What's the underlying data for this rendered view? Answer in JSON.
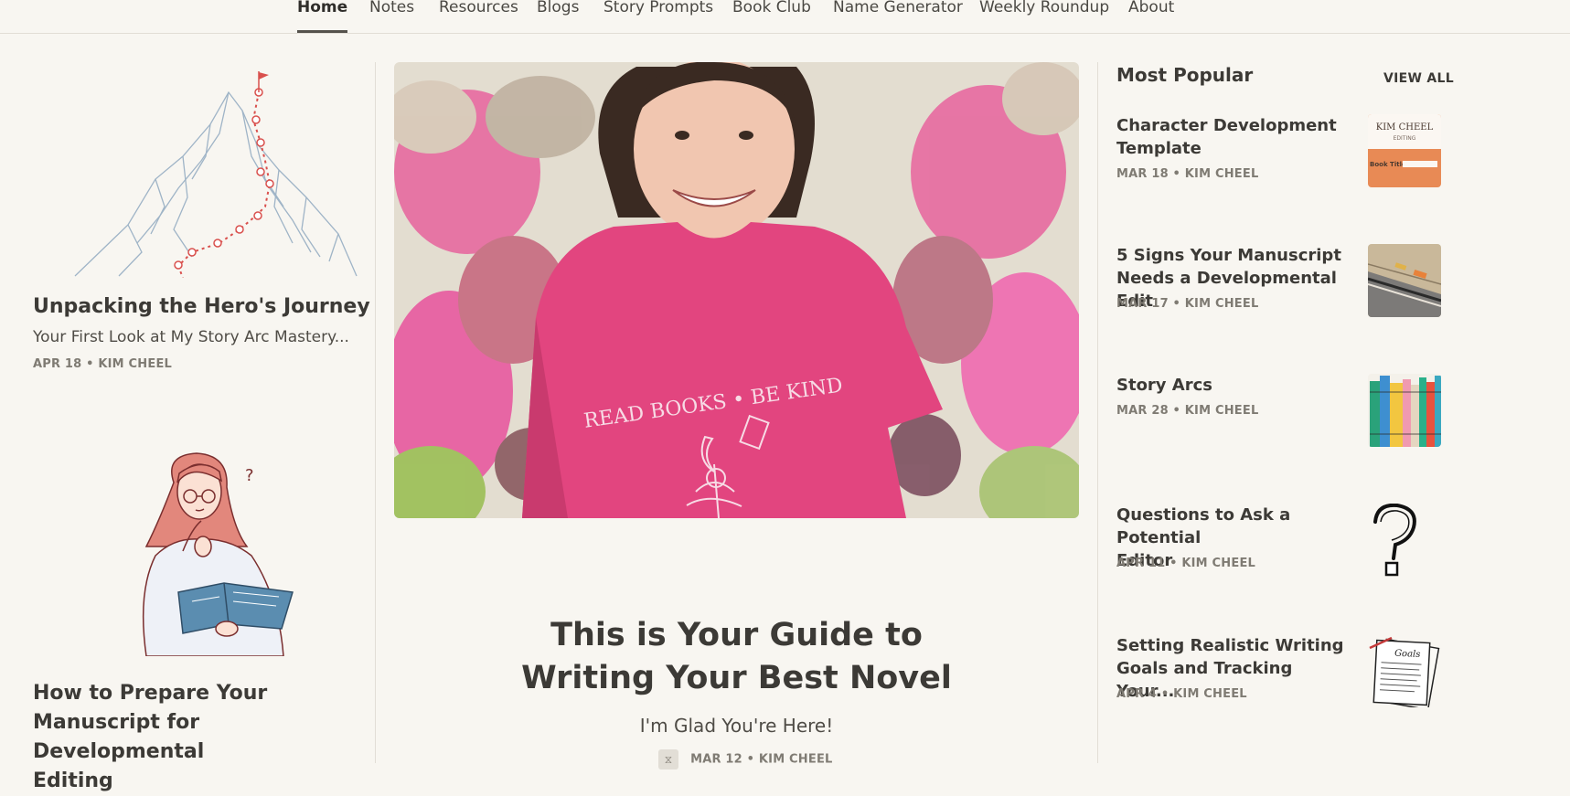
{
  "nav": {
    "items": [
      "Home",
      "Notes",
      "Resources",
      "Blogs",
      "Story Prompts",
      "Book Club",
      "Name Generator",
      "Weekly Roundup",
      "About"
    ]
  },
  "left": {
    "post1": {
      "title": "Unpacking the Hero's Journey",
      "subtitle": "Your First Look at My Story Arc Mastery...",
      "meta": "APR 18 • KIM CHEEL"
    },
    "post2": {
      "title_lines": [
        "How to Prepare Your",
        "Manuscript for Developmental",
        "Editing"
      ]
    }
  },
  "center": {
    "title_lines": [
      "This is Your Guide to",
      "Writing Your Best Novel"
    ],
    "subtitle": "I'm Glad You're Here!",
    "meta": "MAR 12 • KIM CHEEL",
    "shirt_text": "READ BOOKS • BE KIND"
  },
  "right": {
    "heading": "Most Popular",
    "view_all": "VIEW ALL",
    "items": [
      {
        "title_lines": [
          "Character Development",
          "Template"
        ],
        "meta": "MAR 18 • KIM CHEEL",
        "thumb_text": [
          "KIM CHEEL",
          "EDITING",
          "Book Title:"
        ]
      },
      {
        "title_lines": [
          "5 Signs Your Manuscript",
          "Needs a Developmental Edit"
        ],
        "meta": "MAR 17 • KIM CHEEL"
      },
      {
        "title_lines": [
          "Story Arcs"
        ],
        "meta": "MAR 28 • KIM CHEEL"
      },
      {
        "title_lines": [
          "Questions to Ask a Potential",
          "Editor"
        ],
        "meta": "APR 11 • KIM CHEEL"
      },
      {
        "title_lines": [
          "Setting Realistic Writing",
          "Goals and Tracking Your..."
        ],
        "meta": "APR 4 • KIM CHEEL",
        "thumb_text": [
          "Goals"
        ]
      }
    ]
  }
}
